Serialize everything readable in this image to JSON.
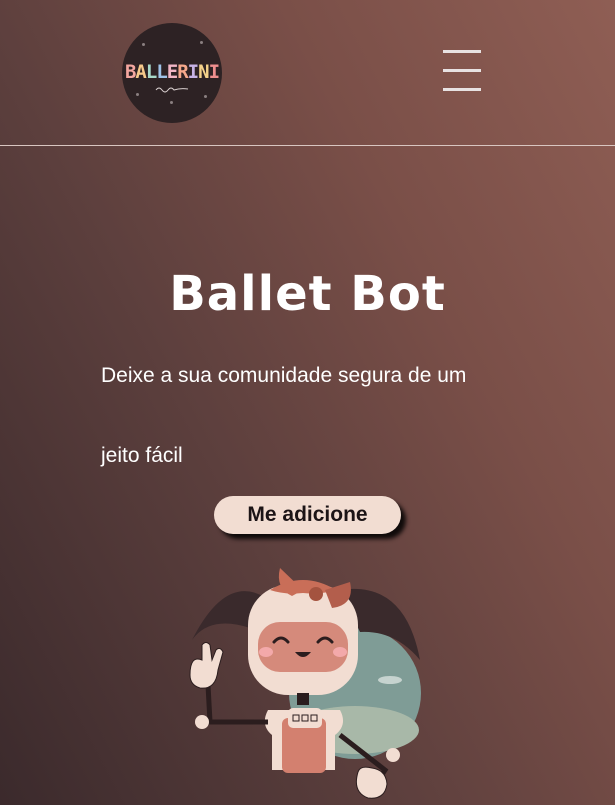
{
  "header": {
    "logo_text": "BALLERINI",
    "logo_letters": [
      "B",
      "A",
      "L",
      "L",
      "E",
      "R",
      "I",
      "N",
      "I"
    ],
    "logo_colors": [
      "#f4a7a0",
      "#f6c98a",
      "#a8d9c9",
      "#9fc3e8",
      "#f2b6c6",
      "#f6a98c",
      "#c7b3e6",
      "#f4d28a",
      "#ef8f8f"
    ],
    "menu_icon": "hamburger-menu-icon"
  },
  "hero": {
    "title": "Ballet Bot",
    "description_line1": "Deixe a sua comunidade segura de um",
    "description_line2": "jeito fácil",
    "cta_label": "Me adicione"
  },
  "illustration": {
    "name": "ballet-bot-robot-mascot",
    "colors": {
      "hair": "#3a2a2c",
      "bow": "#c96e58",
      "face": "#f2ddd2",
      "visor": "#d58a7b",
      "body_accent": "#d3806f",
      "backdrop": "#7a9a95"
    }
  }
}
